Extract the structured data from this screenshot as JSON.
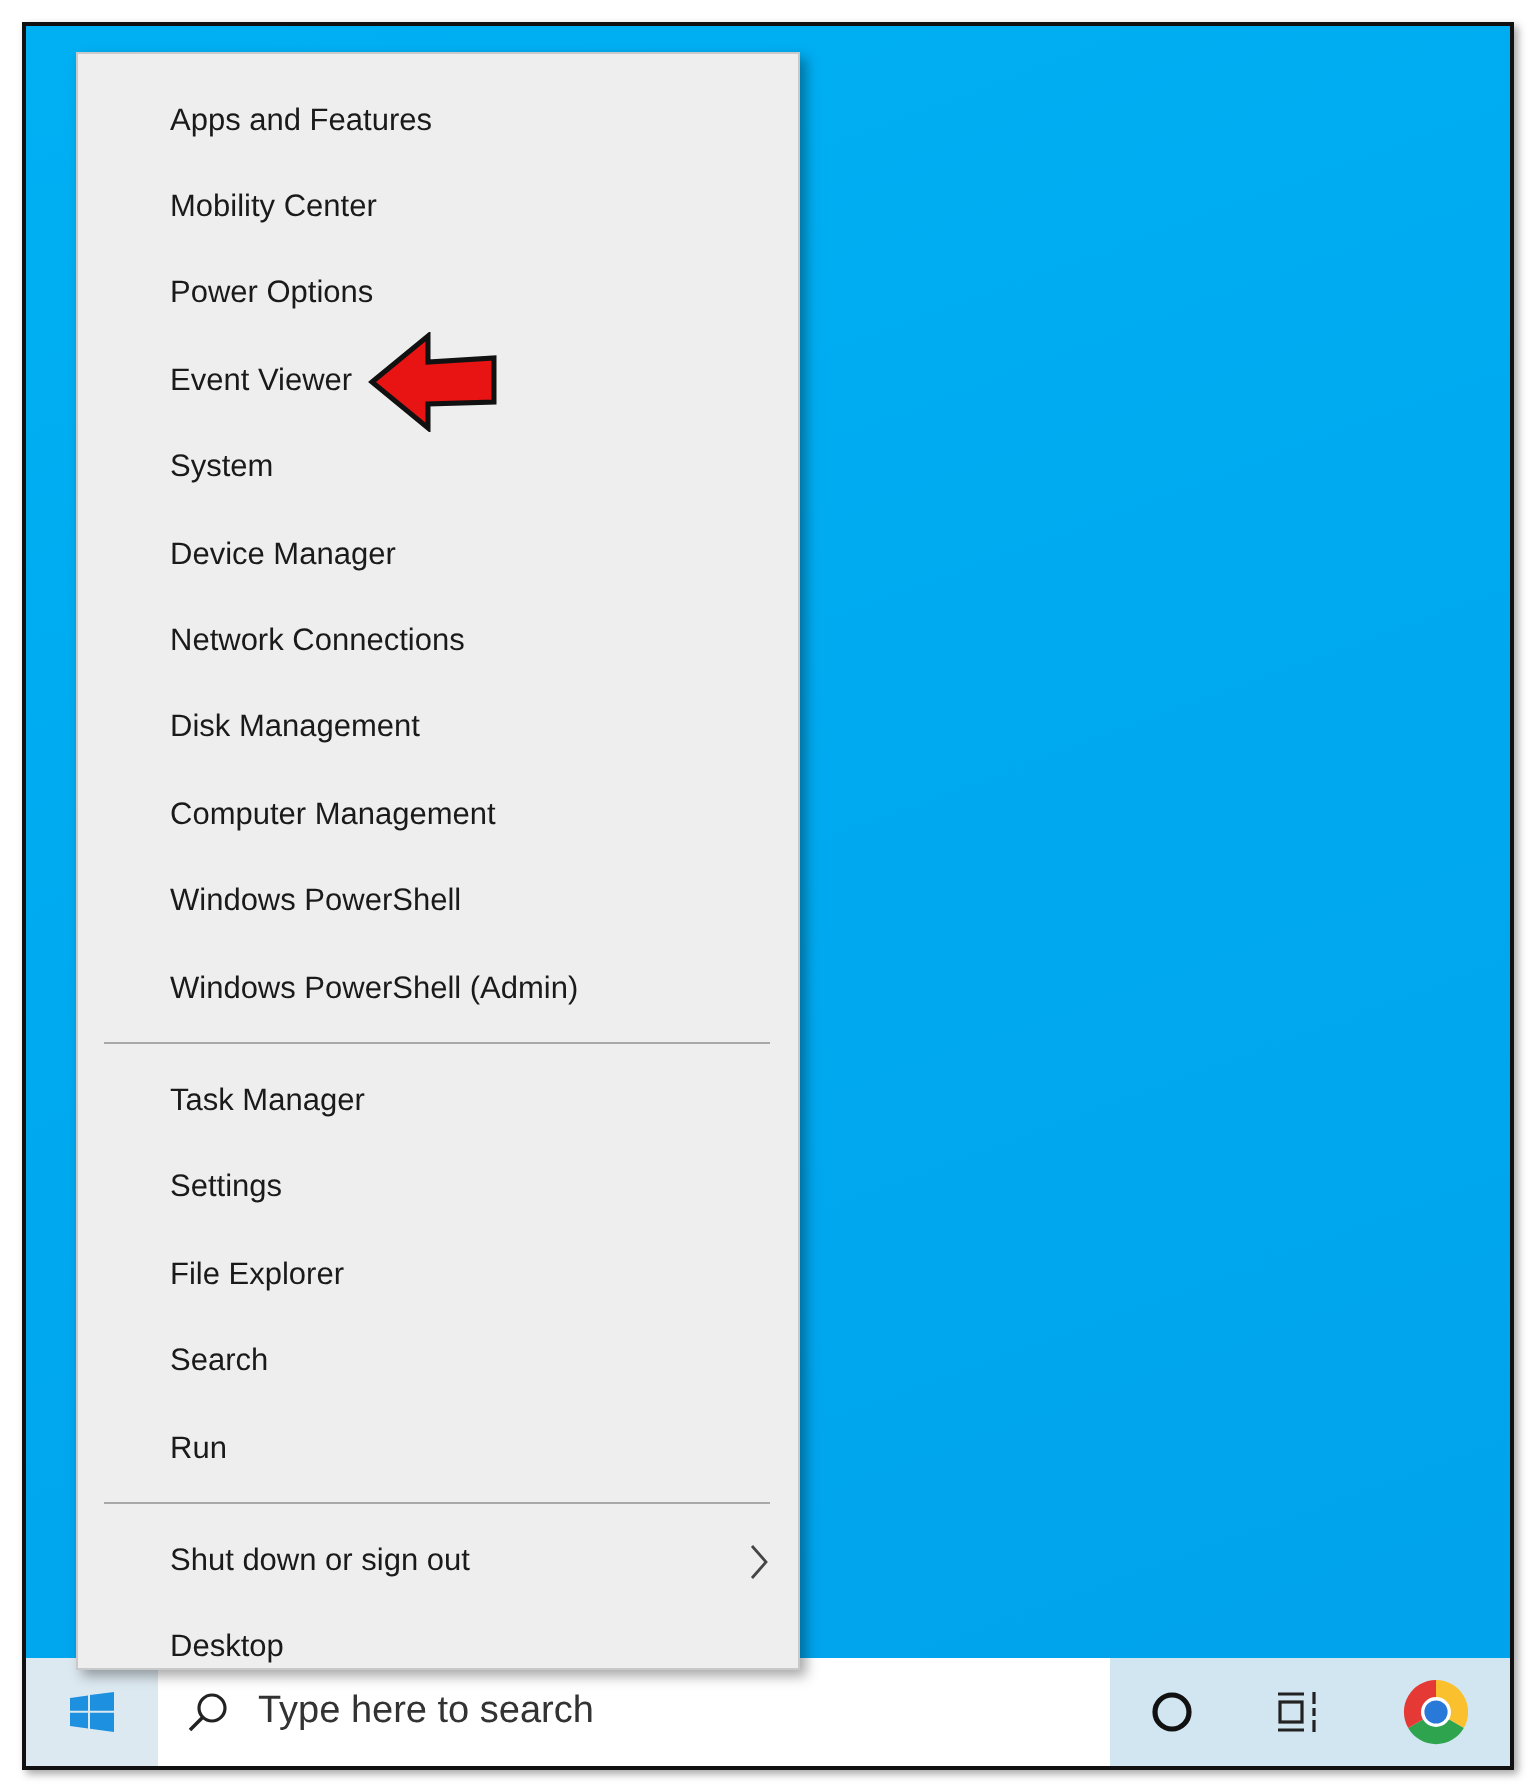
{
  "context_menu": {
    "sections": [
      {
        "items": [
          {
            "label": "Apps and Features",
            "has_submenu": false,
            "annotated": false
          },
          {
            "label": "Mobility Center",
            "has_submenu": false,
            "annotated": false
          },
          {
            "label": "Power Options",
            "has_submenu": false,
            "annotated": false
          },
          {
            "label": "Event Viewer",
            "has_submenu": false,
            "annotated": true
          },
          {
            "label": "System",
            "has_submenu": false,
            "annotated": false
          },
          {
            "label": "Device Manager",
            "has_submenu": false,
            "annotated": false
          },
          {
            "label": "Network Connections",
            "has_submenu": false,
            "annotated": false
          },
          {
            "label": "Disk Management",
            "has_submenu": false,
            "annotated": false
          },
          {
            "label": "Computer Management",
            "has_submenu": false,
            "annotated": false
          },
          {
            "label": "Windows PowerShell",
            "has_submenu": false,
            "annotated": false
          },
          {
            "label": "Windows PowerShell (Admin)",
            "has_submenu": false,
            "annotated": false
          }
        ]
      },
      {
        "items": [
          {
            "label": "Task Manager",
            "has_submenu": false,
            "annotated": false
          },
          {
            "label": "Settings",
            "has_submenu": false,
            "annotated": false
          },
          {
            "label": "File Explorer",
            "has_submenu": false,
            "annotated": false
          },
          {
            "label": "Search",
            "has_submenu": false,
            "annotated": false
          },
          {
            "label": "Run",
            "has_submenu": false,
            "annotated": false
          }
        ]
      },
      {
        "items": [
          {
            "label": "Shut down or sign out",
            "has_submenu": true,
            "annotated": false
          },
          {
            "label": "Desktop",
            "has_submenu": false,
            "annotated": false
          }
        ]
      }
    ]
  },
  "taskbar": {
    "search": {
      "placeholder": "Type here to search"
    }
  }
}
